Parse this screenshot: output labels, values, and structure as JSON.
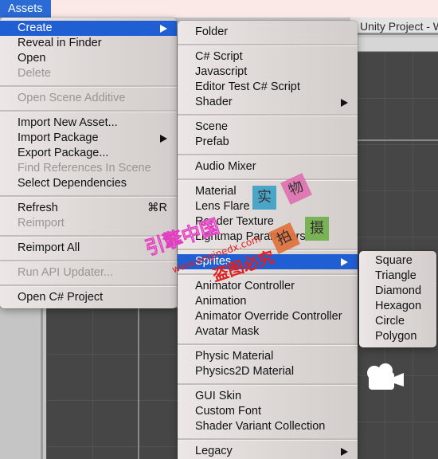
{
  "menubar": {
    "active_menu": "Assets"
  },
  "window": {
    "title": "Unity Project - W"
  },
  "assets_menu": {
    "groups": [
      [
        {
          "label": "Create",
          "state": "active",
          "submenu": true
        },
        {
          "label": "Reveal in Finder",
          "state": "enabled"
        },
        {
          "label": "Open",
          "state": "enabled"
        },
        {
          "label": "Delete",
          "state": "disabled"
        }
      ],
      [
        {
          "label": "Open Scene Additive",
          "state": "disabled"
        }
      ],
      [
        {
          "label": "Import New Asset...",
          "state": "enabled"
        },
        {
          "label": "Import Package",
          "state": "enabled",
          "submenu": true
        },
        {
          "label": "Export Package...",
          "state": "enabled"
        },
        {
          "label": "Find References In Scene",
          "state": "disabled"
        },
        {
          "label": "Select Dependencies",
          "state": "enabled"
        }
      ],
      [
        {
          "label": "Refresh",
          "state": "enabled",
          "shortcut": "⌘R"
        },
        {
          "label": "Reimport",
          "state": "disabled"
        }
      ],
      [
        {
          "label": "Reimport All",
          "state": "enabled"
        }
      ],
      [
        {
          "label": "Run API Updater...",
          "state": "disabled"
        }
      ],
      [
        {
          "label": "Open C# Project",
          "state": "enabled"
        }
      ]
    ]
  },
  "create_menu": {
    "groups": [
      [
        {
          "label": "Folder",
          "state": "enabled"
        }
      ],
      [
        {
          "label": "C# Script",
          "state": "enabled"
        },
        {
          "label": "Javascript",
          "state": "enabled"
        },
        {
          "label": "Editor Test C# Script",
          "state": "enabled"
        },
        {
          "label": "Shader",
          "state": "enabled",
          "submenu": true
        }
      ],
      [
        {
          "label": "Scene",
          "state": "enabled"
        },
        {
          "label": "Prefab",
          "state": "enabled"
        }
      ],
      [
        {
          "label": "Audio Mixer",
          "state": "enabled"
        }
      ],
      [
        {
          "label": "Material",
          "state": "enabled"
        },
        {
          "label": "Lens Flare",
          "state": "enabled"
        },
        {
          "label": "Render Texture",
          "state": "enabled"
        },
        {
          "label": "Lightmap Parameters",
          "state": "enabled"
        }
      ],
      [
        {
          "label": "Sprites",
          "state": "active",
          "submenu": true
        }
      ],
      [
        {
          "label": "Animator Controller",
          "state": "enabled"
        },
        {
          "label": "Animation",
          "state": "enabled"
        },
        {
          "label": "Animator Override Controller",
          "state": "enabled"
        },
        {
          "label": "Avatar Mask",
          "state": "enabled"
        }
      ],
      [
        {
          "label": "Physic Material",
          "state": "enabled"
        },
        {
          "label": "Physics2D Material",
          "state": "enabled"
        }
      ],
      [
        {
          "label": "GUI Skin",
          "state": "enabled"
        },
        {
          "label": "Custom Font",
          "state": "enabled"
        },
        {
          "label": "Shader Variant Collection",
          "state": "enabled"
        }
      ],
      [
        {
          "label": "Legacy",
          "state": "enabled",
          "submenu": true
        }
      ]
    ]
  },
  "sprites_menu": {
    "items": [
      {
        "label": "Square",
        "state": "enabled"
      },
      {
        "label": "Triangle",
        "state": "enabled"
      },
      {
        "label": "Diamond",
        "state": "enabled"
      },
      {
        "label": "Hexagon",
        "state": "enabled"
      },
      {
        "label": "Circle",
        "state": "enabled"
      },
      {
        "label": "Polygon",
        "state": "enabled"
      }
    ]
  },
  "watermark": {
    "brand": "引擎中国",
    "url": "www.enginedx.com",
    "warning": "盗图必究",
    "blocks": [
      {
        "char": "实",
        "color": "#3aa0c8"
      },
      {
        "char": "物",
        "color": "#e070b0"
      },
      {
        "char": "拍",
        "color": "#e0703a"
      },
      {
        "char": "摄",
        "color": "#70b048"
      }
    ],
    "brand_color": "#e040c0",
    "url_color": "#e02020"
  }
}
